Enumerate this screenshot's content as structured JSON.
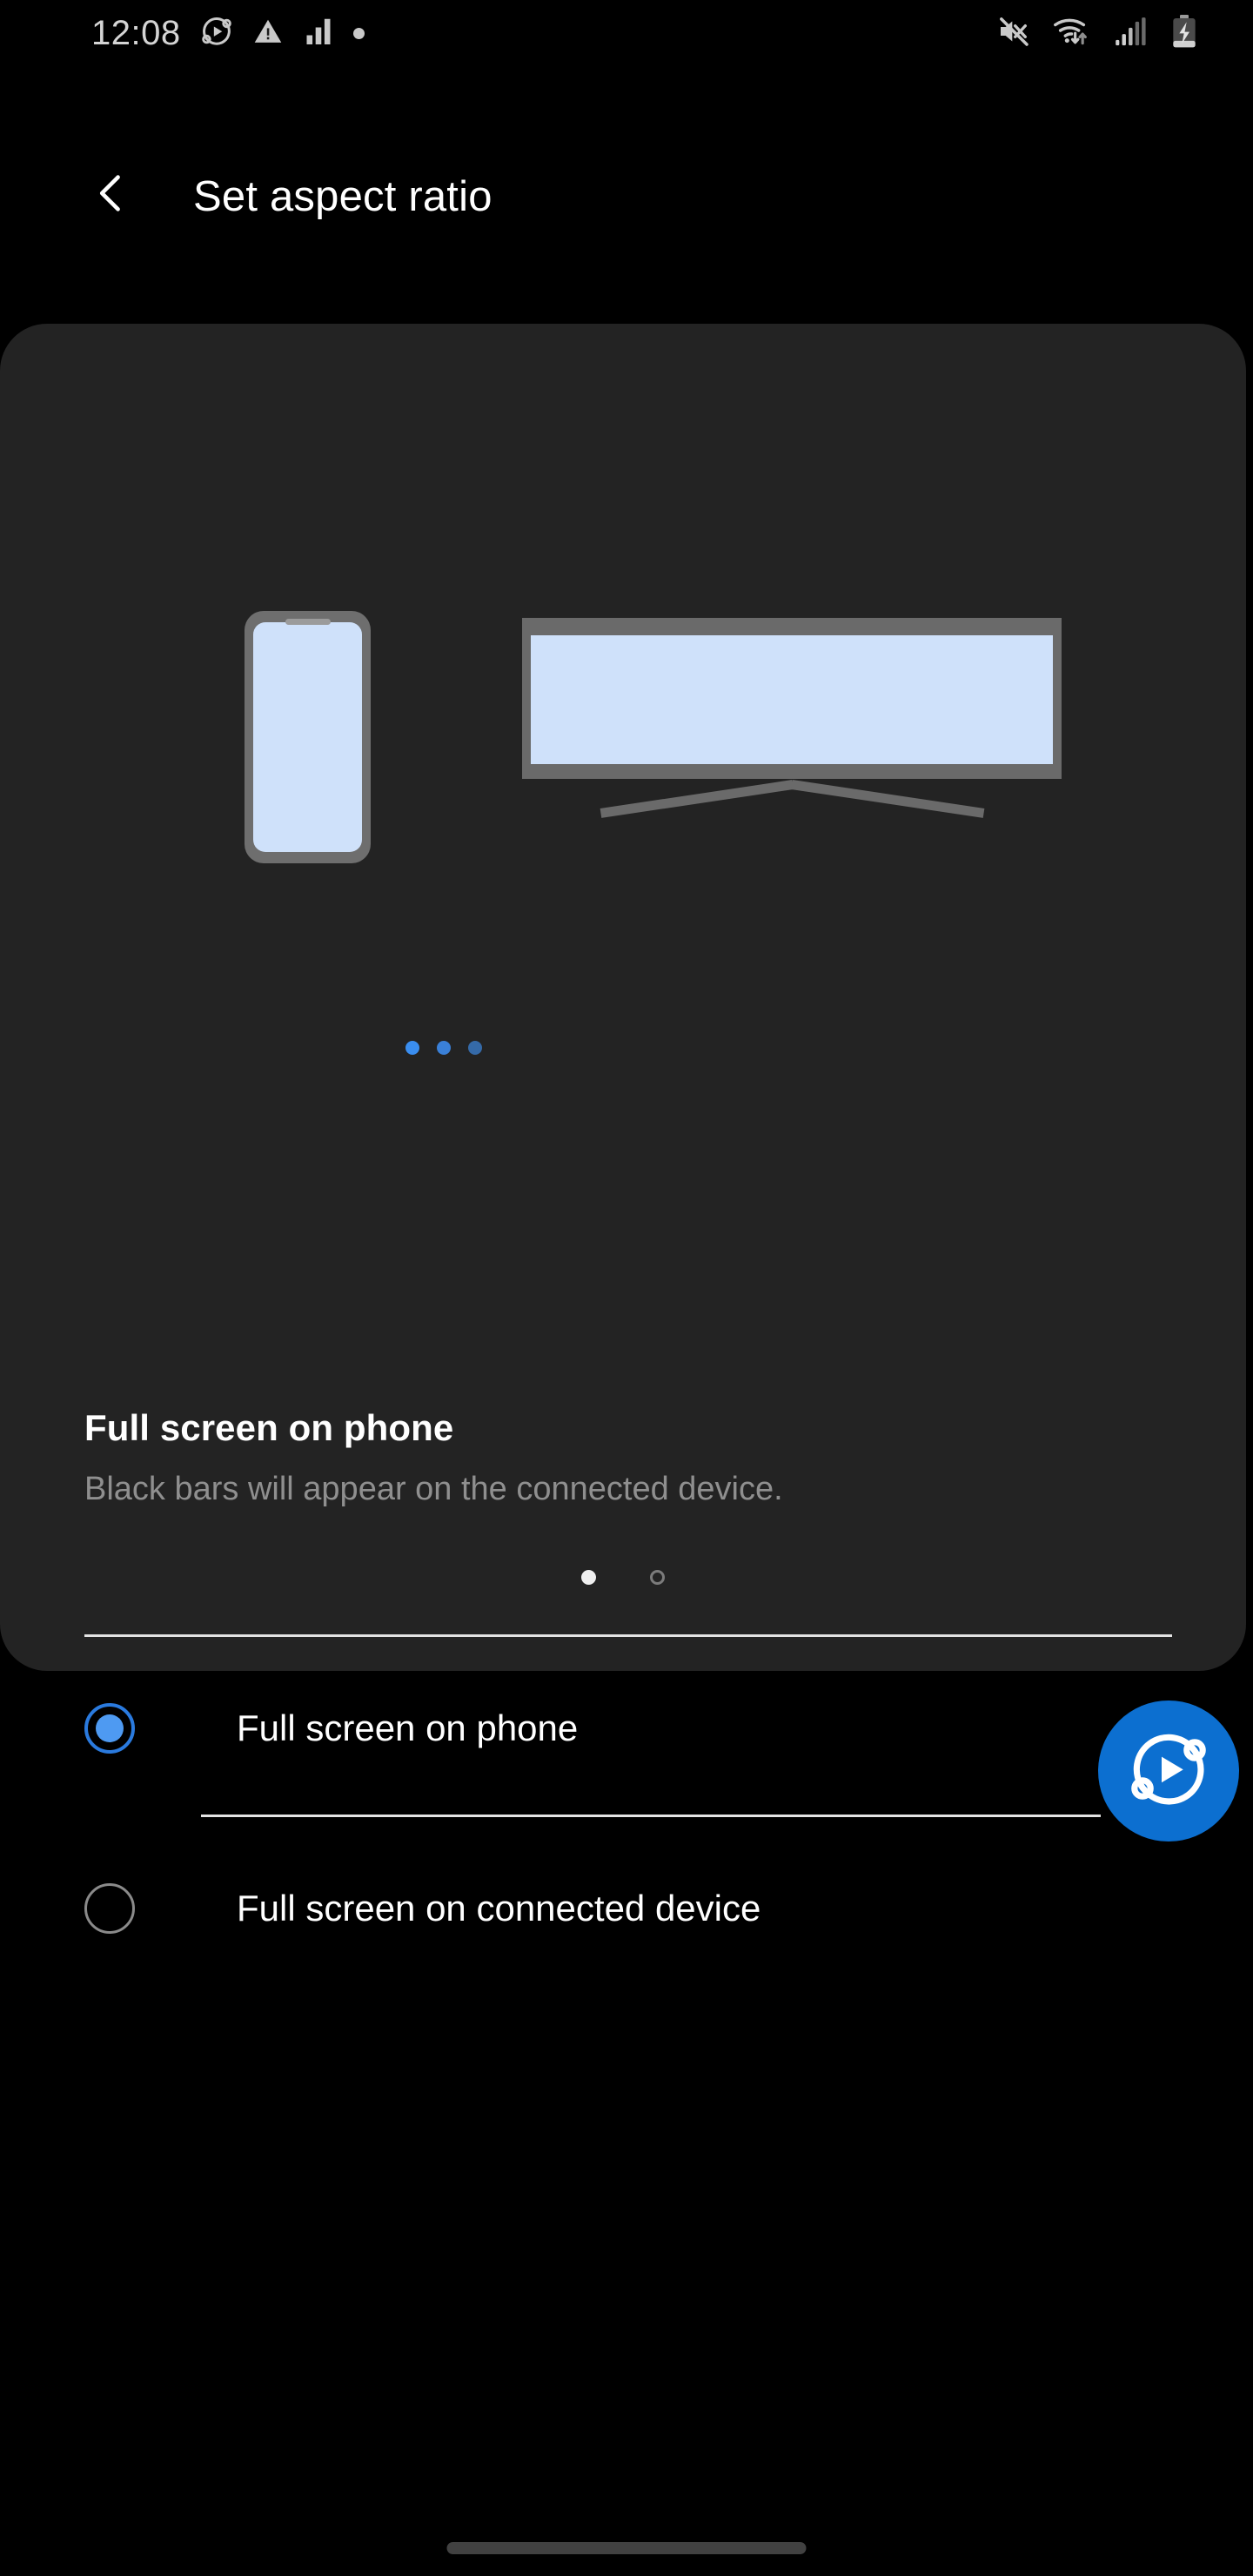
{
  "status_bar": {
    "time": "12:08",
    "left_icons": [
      "smart-view-icon",
      "warning-triangle-icon",
      "signal-bars-icon",
      "dot-icon"
    ],
    "right_icons": [
      "mute-icon",
      "wifi-icon",
      "cellular-signal-icon",
      "battery-charging-icon"
    ]
  },
  "header": {
    "title": "Set aspect ratio",
    "back_icon": "chevron-left-icon"
  },
  "illustration": {
    "phone_alt": "phone device",
    "tv_alt": "connected tv device",
    "connection_dots": 3,
    "screen_color": "#cfe1fa",
    "bezel_color": "#6a6a6a",
    "dot_color": "#3a8ef0"
  },
  "preview": {
    "heading": "Full screen on phone",
    "description": "Black bars will appear on the connected device."
  },
  "pager": {
    "total": 2,
    "active_index": 0
  },
  "options": {
    "selected_index": 0,
    "items": [
      {
        "label": "Full screen on phone",
        "selected": true
      },
      {
        "label": "Full screen on connected device",
        "selected": false
      }
    ]
  },
  "fab": {
    "icon": "smart-view-icon",
    "color": "#0c6fd0"
  },
  "navigation": {
    "home_indicator": "home-indicator-pill"
  }
}
